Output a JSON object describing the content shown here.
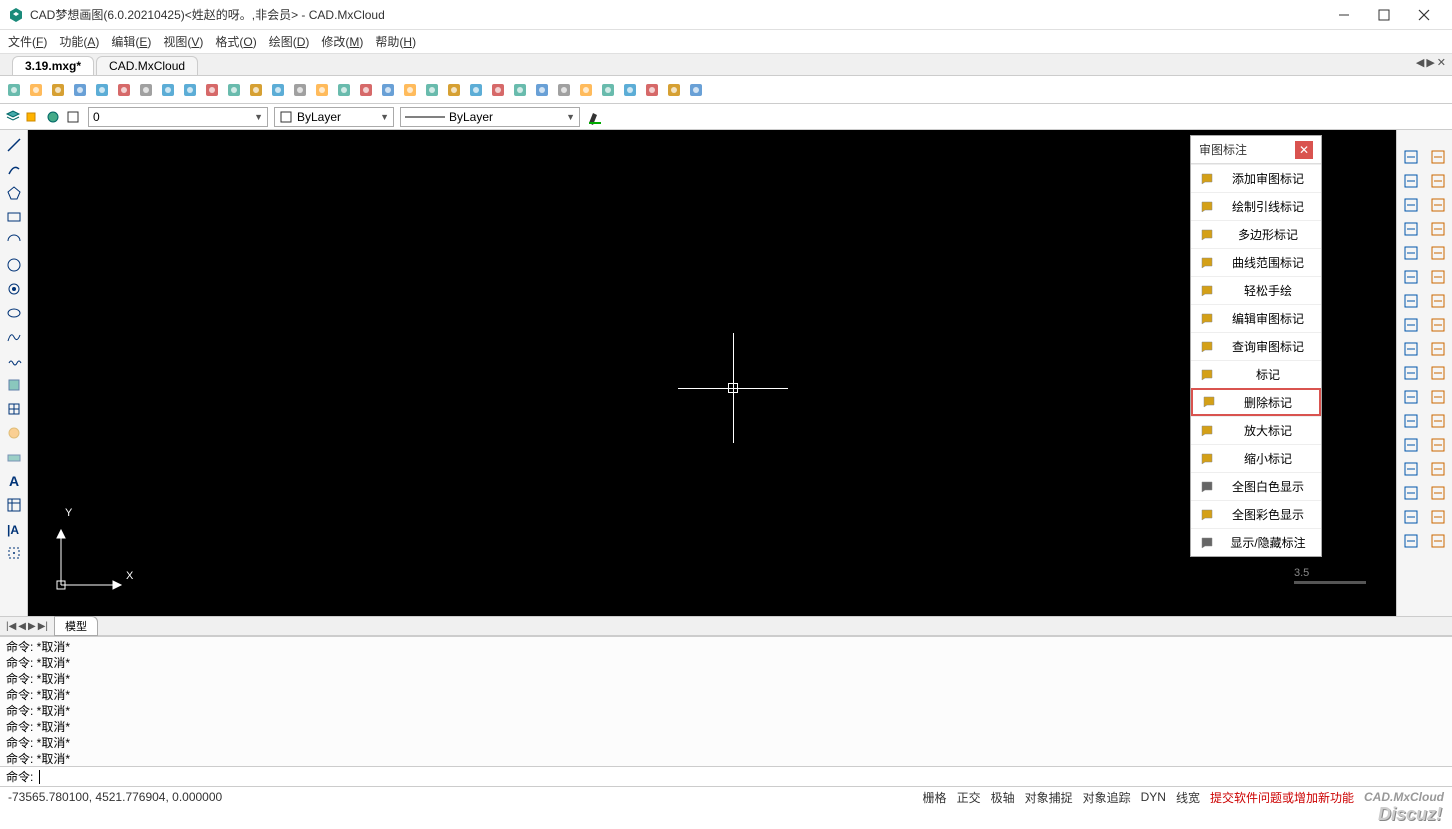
{
  "window": {
    "title": "CAD梦想画图(6.0.20210425)<姓赵的呀。,非会员> - CAD.MxCloud"
  },
  "menu": {
    "items": [
      {
        "label": "文件",
        "key": "F"
      },
      {
        "label": "功能",
        "key": "A"
      },
      {
        "label": "编辑",
        "key": "E"
      },
      {
        "label": "视图",
        "key": "V"
      },
      {
        "label": "格式",
        "key": "O"
      },
      {
        "label": "绘图",
        "key": "D"
      },
      {
        "label": "修改",
        "key": "M"
      },
      {
        "label": "帮助",
        "key": "H"
      }
    ]
  },
  "tabs": {
    "items": [
      {
        "label": "CAD.MxCloud",
        "active": false
      },
      {
        "label": "3.19.mxg*",
        "active": true
      }
    ]
  },
  "layer": {
    "current": "0",
    "linetype": "ByLayer",
    "lineweight": "ByLayer"
  },
  "left_tools": [
    "line-icon",
    "arc-tool-icon",
    "polygon-icon",
    "rectangle-icon",
    "circle-icon",
    "arc-icon",
    "donut-icon",
    "ellipse-icon",
    "spline-icon",
    "revcloud-icon",
    "hatch-icon",
    "insert-icon",
    "region-icon",
    "block-icon",
    "text-icon",
    "table-icon",
    "multiline-icon",
    "point-icon"
  ],
  "right_tools_col1": [
    "dim-linear-icon",
    "dim-aligned-icon",
    "dim-angular-icon",
    "dim-radius-icon",
    "dim-diameter-icon",
    "dim-ordinate-icon",
    "grid-icon",
    "tolerance-icon",
    "leader-icon",
    "dimedit-icon",
    "dimstyle-icon",
    "jog-icon",
    "continue-icon",
    "baseline-icon",
    "break-icon",
    "cut-icon",
    "extend-icon"
  ],
  "right_tools_col2": [
    "measure-icon",
    "repeat-icon",
    "copy-icon",
    "mirror-icon",
    "offset-icon",
    "array-icon",
    "move-icon",
    "rotate-icon",
    "scale-icon",
    "stretch-icon",
    "trim-icon",
    "extend2-icon",
    "break2-icon",
    "join-icon",
    "chamfer-icon",
    "fillet-icon",
    "explode-icon"
  ],
  "review_panel": {
    "title": "审图标注",
    "items": [
      {
        "label": "添加审图标记",
        "icon_color": "#d4a017"
      },
      {
        "label": "绘制引线标记",
        "icon_color": "#d4a017"
      },
      {
        "label": "多边形标记",
        "icon_color": "#d4a017"
      },
      {
        "label": "曲线范围标记",
        "icon_color": "#d4a017"
      },
      {
        "label": "轻松手绘",
        "icon_color": "#d4a017"
      },
      {
        "label": "编辑审图标记",
        "icon_color": "#d4a017"
      },
      {
        "label": "查询审图标记",
        "icon_color": "#d4a017"
      },
      {
        "label": "标记",
        "icon_color": "#d4a017"
      },
      {
        "label": "删除标记",
        "icon_color": "#d4a017",
        "highlighted": true
      },
      {
        "label": "放大标记",
        "icon_color": "#d4a017"
      },
      {
        "label": "缩小标记",
        "icon_color": "#d4a017"
      },
      {
        "label": "全图白色显示",
        "icon_color": "#666"
      },
      {
        "label": "全图彩色显示",
        "icon_color": "#d4a017"
      },
      {
        "label": "显示/隐藏标注",
        "icon_color": "#666"
      }
    ]
  },
  "model_tab": {
    "label": "模型"
  },
  "scale_value": "3.5",
  "command": {
    "history": [
      "命令: *取消*",
      "命令: *取消*",
      "命令: *取消*",
      "命令: *取消*",
      "命令: *取消*",
      "命令: *取消*",
      "命令: *取消*",
      "命令: *取消*"
    ],
    "prompt": "命令:",
    "input": ""
  },
  "status": {
    "coords": "-73565.780100,  4521.776904,  0.000000",
    "toggles": [
      "栅格",
      "正交",
      "极轴",
      "对象捕捉",
      "对象追踪",
      "DYN",
      "线宽"
    ],
    "link": "提交软件问题或增加新功能",
    "brand": "CAD.MxCloud"
  },
  "watermark": "Discuz!"
}
